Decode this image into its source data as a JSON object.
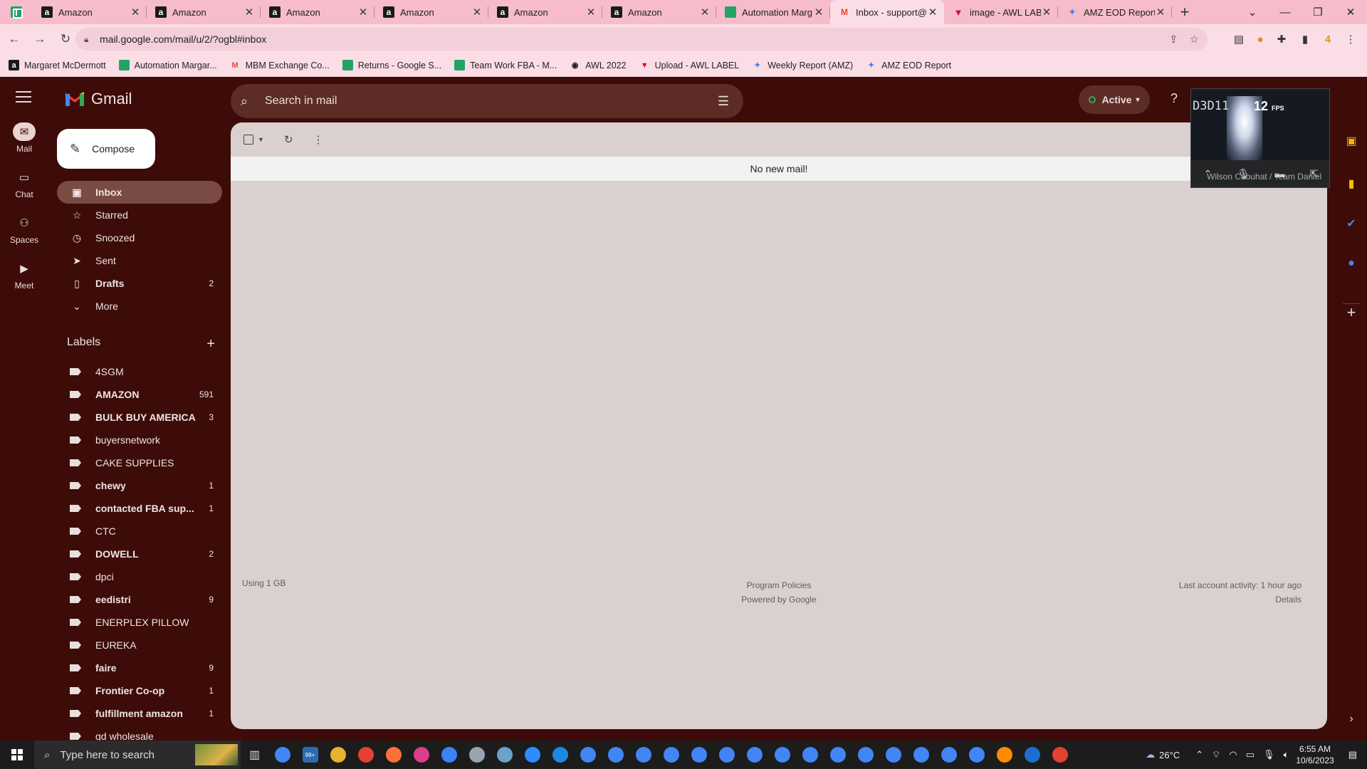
{
  "browser": {
    "tabs": [
      {
        "title": "Amazon",
        "favicon": "amazon-icon"
      },
      {
        "title": "Amazon",
        "favicon": "amazon-icon"
      },
      {
        "title": "Amazon",
        "favicon": "amazon-icon"
      },
      {
        "title": "Amazon",
        "favicon": "amazon-icon"
      },
      {
        "title": "Amazon",
        "favicon": "amazon-icon"
      },
      {
        "title": "Amazon",
        "favicon": "amazon-icon"
      },
      {
        "title": "Automation Marg",
        "favicon": "sheets-icon"
      },
      {
        "title": "Inbox - support@",
        "favicon": "gmail-icon",
        "active": true
      },
      {
        "title": "image - AWL LAB",
        "favicon": "awl-icon"
      },
      {
        "title": "AMZ EOD Report",
        "favicon": "amz-report-icon"
      }
    ],
    "url": "mail.google.com/mail/u/2/?ogbl#inbox",
    "extension_badge": "4",
    "bookmarks": [
      {
        "label": "Margaret McDermott",
        "favicon": "amazon-icon"
      },
      {
        "label": "Automation Margar...",
        "favicon": "sheets-icon"
      },
      {
        "label": "MBM Exchange Co...",
        "favicon": "gmail-icon"
      },
      {
        "label": "Returns - Google S...",
        "favicon": "sheets-icon"
      },
      {
        "label": "Team Work FBA - M...",
        "favicon": "sheets-icon"
      },
      {
        "label": "AWL 2022",
        "favicon": "globe-icon"
      },
      {
        "label": "Upload - AWL LABEL",
        "favicon": "awl-icon"
      },
      {
        "label": "Weekly Report (AMZ)",
        "favicon": "amz-report-icon"
      },
      {
        "label": "AMZ EOD Report",
        "favicon": "amz-report-icon"
      }
    ]
  },
  "gmail": {
    "brand": "Gmail",
    "search_placeholder": "Search in mail",
    "status": "Active",
    "rail": [
      {
        "label": "Mail",
        "icon": "mail-icon",
        "selected": true
      },
      {
        "label": "Chat",
        "icon": "chat-icon"
      },
      {
        "label": "Spaces",
        "icon": "spaces-icon"
      },
      {
        "label": "Meet",
        "icon": "meet-icon"
      }
    ],
    "compose": "Compose",
    "nav": [
      {
        "label": "Inbox",
        "icon": "inbox-icon",
        "count": "",
        "selected": true
      },
      {
        "label": "Starred",
        "icon": "star-icon",
        "count": ""
      },
      {
        "label": "Snoozed",
        "icon": "clock-icon",
        "count": ""
      },
      {
        "label": "Sent",
        "icon": "send-icon",
        "count": ""
      },
      {
        "label": "Drafts",
        "icon": "draft-icon",
        "count": "2",
        "bold": true
      },
      {
        "label": "More",
        "icon": "chevron-down-icon",
        "count": ""
      }
    ],
    "labels_heading": "Labels",
    "labels": [
      {
        "name": "4SGM",
        "count": "",
        "bold": false
      },
      {
        "name": "AMAZON",
        "count": "591",
        "bold": true
      },
      {
        "name": "BULK BUY AMERICA",
        "count": "3",
        "bold": true
      },
      {
        "name": "buyersnetwork",
        "count": "",
        "bold": false
      },
      {
        "name": "CAKE SUPPLIES",
        "count": "",
        "bold": false
      },
      {
        "name": "chewy",
        "count": "1",
        "bold": true
      },
      {
        "name": "contacted FBA sup...",
        "count": "1",
        "bold": true
      },
      {
        "name": "CTC",
        "count": "",
        "bold": false
      },
      {
        "name": "DOWELL",
        "count": "2",
        "bold": true
      },
      {
        "name": "dpci",
        "count": "",
        "bold": false
      },
      {
        "name": "eedistri",
        "count": "9",
        "bold": true
      },
      {
        "name": "ENERPLEX PILLOW",
        "count": "",
        "bold": false
      },
      {
        "name": "EUREKA",
        "count": "",
        "bold": false
      },
      {
        "name": "faire",
        "count": "9",
        "bold": true
      },
      {
        "name": "Frontier Co-op",
        "count": "1",
        "bold": true
      },
      {
        "name": "fulfillment amazon",
        "count": "1",
        "bold": true
      },
      {
        "name": "gd wholesale",
        "count": "",
        "bold": false
      }
    ],
    "empty_message": "No new mail!",
    "footer": {
      "storage": "Using 1 GB",
      "policies": "Program Policies",
      "powered": "Powered by Google",
      "activity": "Last account activity: 1 hour ago",
      "details": "Details"
    }
  },
  "video_overlay": {
    "overlay_text": "D3D11",
    "fps_value": "12",
    "fps_unit": "FPS",
    "caller": "Wilson Cabuhat / Team Daniel"
  },
  "taskbar": {
    "search_placeholder": "Type here to search",
    "mail_badge": "99+",
    "weather": "26°C",
    "time": "6:55 AM",
    "date": "10/6/2023"
  },
  "colors": {
    "theme_bg": "#3d0c08",
    "main_panel": "#d9d0cf",
    "browser_tabstrip": "#f6bccc"
  }
}
